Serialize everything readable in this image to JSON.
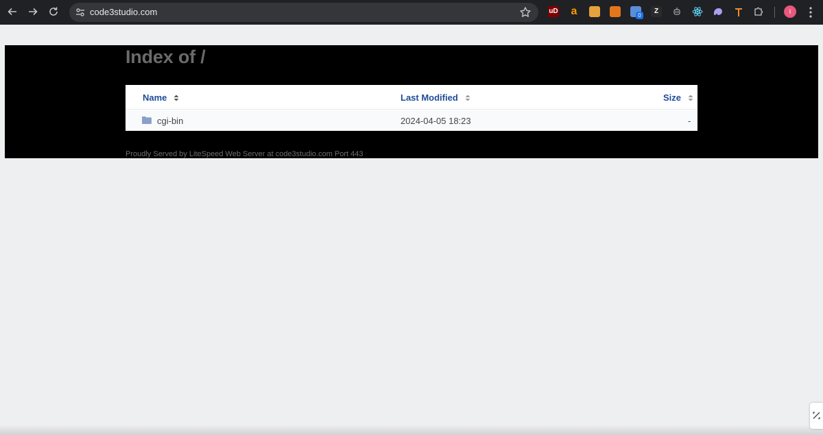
{
  "browser": {
    "url": "code3studio.com",
    "extension_badge": "0",
    "profile_initial": "I",
    "extensions": [
      {
        "icon": "ublock-icon",
        "glyph": "uD",
        "color": "#800000"
      },
      {
        "icon": "amazon-icon",
        "glyph": "a",
        "color": "#ff9900"
      },
      {
        "icon": "coupon-icon",
        "glyph": "",
        "color": "#e6a23c"
      },
      {
        "icon": "metamask-icon",
        "glyph": "",
        "color": "#e2761b"
      },
      {
        "icon": "cloud-extension-icon",
        "glyph": "",
        "color": "#5b8ed6"
      },
      {
        "icon": "zeal-icon",
        "glyph": "Z",
        "color": "#2b2b2b"
      },
      {
        "icon": "robot-icon",
        "glyph": "",
        "color": "#c4c7c5"
      },
      {
        "icon": "react-devtools-icon",
        "glyph": "",
        "color": "#61dafb"
      },
      {
        "icon": "phantom-icon",
        "glyph": "",
        "color": "#ab9ff2"
      },
      {
        "icon": "arrow-up-extension-icon",
        "glyph": "",
        "color": "#f28b30"
      },
      {
        "icon": "puzzle-icon",
        "glyph": "",
        "color": "#c4c7c5"
      }
    ]
  },
  "page": {
    "title": "Index of /",
    "columns": {
      "name": "Name",
      "modified": "Last Modified",
      "size": "Size"
    },
    "rows": [
      {
        "name": "cgi-bin",
        "modified": "2024-04-05 18:23",
        "size": "-",
        "icon": "folder-icon"
      }
    ],
    "footer": "Proudly Served by LiteSpeed Web Server at code3studio.com Port 443"
  },
  "colors": {
    "header_link": "#1f4b99",
    "folder": "#8aa0c8"
  }
}
